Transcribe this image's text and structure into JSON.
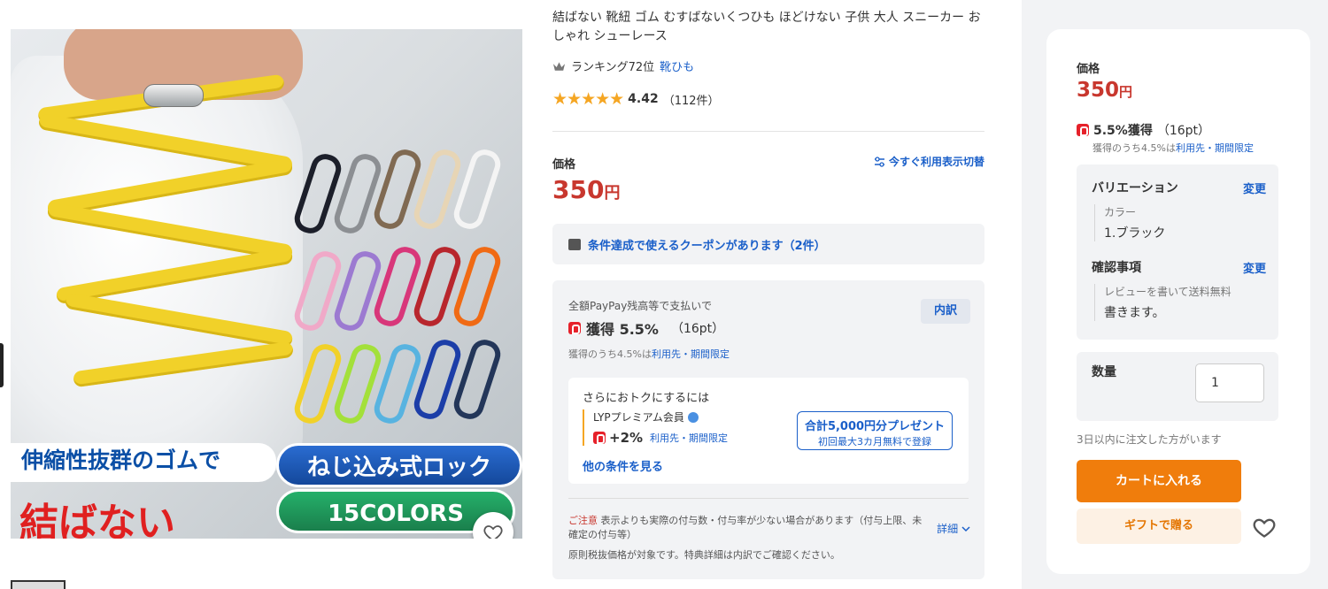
{
  "product": {
    "title": "結ばない 靴紐 ゴム むすばないくつひも ほどけない 子供 大人 スニーカー おしゃれ シューレース",
    "ranking_text": "ランキング72位",
    "ranking_category": "靴ひも",
    "rating_stars": "★★★★★",
    "rating_value": 4.42,
    "rating_score": "4.42",
    "review_count": "（112件）",
    "image_banner_line1": "伸縮性抜群のゴムで",
    "image_banner_main": "結ばない",
    "image_pill_1": "ねじ込み式ロック",
    "image_pill_2": "15COLORS"
  },
  "price_section": {
    "label": "価格",
    "value": "350",
    "unit": "円",
    "toggle_display_label": "今すぐ利用表示切替"
  },
  "coupon": {
    "text": "条件達成で使えるクーポンがあります（2件）"
  },
  "paypay": {
    "lead": "全額PayPay残高等で支払いで",
    "earn_label": "獲得 5.5%",
    "earn_points": "（16pt）",
    "breakdown_label": "内訳",
    "note_prefix": "獲得のうち4.5%は",
    "note_link": "利用先・期間限定",
    "more_title": "さらにおトクにするには",
    "lyp_name": "LYPプレミアム会員",
    "lyp_plus": "+2%",
    "lyp_plus_note": "利用先・期間限定",
    "present_line1": "合計5,000円分プレゼント",
    "present_line2": "初回最大3カ月無料で登録",
    "other_conditions": "他の条件を見る",
    "caution_label": "ご注意",
    "caution_text": "表示よりも実際の付与数・付与率が少ない場合があります（付与上限、未確定の付与等）",
    "detail_label": "詳細",
    "tax_note": "原則税抜価格が対象です。特典詳細は内訳でご確認ください。"
  },
  "side_card": {
    "price_label": "価格",
    "price_value": "350",
    "price_unit": "円",
    "earn_rate": "5.5%獲得",
    "earn_points": "（16pt）",
    "earn_note_prefix": "獲得のうち4.5%は",
    "earn_note_link": "利用先・期間限定",
    "variation_heading": "バリエーション",
    "variation_change": "変更",
    "color_label": "カラー",
    "color_value": "1.ブラック",
    "confirm_heading": "確認事項",
    "confirm_change": "変更",
    "confirm_label": "レビューを書いて送料無料",
    "confirm_value": "書きます。",
    "quantity_label": "数量",
    "quantity_value": "1",
    "order_note": "3日以内に注文した方がいます",
    "cart_button": "カートに入れる",
    "gift_button": "ギフトで贈る"
  },
  "colors": {
    "price_red": "#c8372e",
    "link_blue": "#1a5fc9",
    "cart_orange": "#f07d0c",
    "star_orange": "#f5a623",
    "paypay_red": "#e6212a"
  },
  "icons": [
    "crown-icon",
    "star-icon",
    "settings-toggle-icon",
    "coupon-icon",
    "paypay-icon",
    "lyp-badge-icon",
    "chevron-down-icon",
    "heart-icon"
  ]
}
